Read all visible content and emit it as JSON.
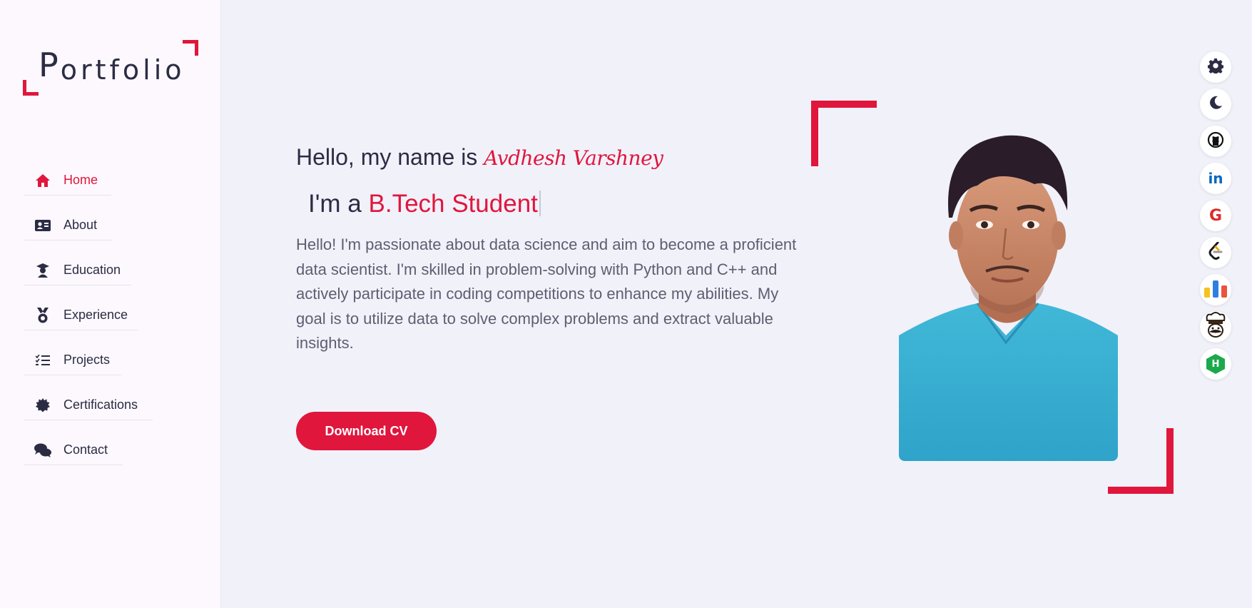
{
  "sidebar": {
    "logo": "Portfolio",
    "logo_first": "P",
    "logo_rest": "ortfolio",
    "items": [
      {
        "label": "Home",
        "icon": "home-icon",
        "active": true
      },
      {
        "label": "About",
        "icon": "id-card-icon"
      },
      {
        "label": "Education",
        "icon": "graduate-icon"
      },
      {
        "label": "Experience",
        "icon": "medal-icon"
      },
      {
        "label": "Projects",
        "icon": "tasks-icon"
      },
      {
        "label": "Certifications",
        "icon": "certificate-icon"
      },
      {
        "label": "Contact",
        "icon": "chat-icon"
      }
    ]
  },
  "hero": {
    "greeting": "Hello, my name is",
    "name": "Avdhesh Varshney",
    "role_prefix": "I'm a",
    "role": "B.Tech Student",
    "bio": "Hello! I'm passionate about data science and aim to become a proficient data scientist. I'm skilled in problem-solving with Python and C++ and actively participate in coding competitions to enhance my abilities. My goal is to utilize data to solve complex problems and extract valuable insights.",
    "cv_button": "Download CV"
  },
  "social": [
    {
      "name": "settings",
      "icon": "gear-icon"
    },
    {
      "name": "dark-mode",
      "icon": "moon-icon"
    },
    {
      "name": "github",
      "icon": "github-icon"
    },
    {
      "name": "linkedin",
      "icon": "linkedin-icon",
      "text": "in"
    },
    {
      "name": "google",
      "icon": "google-icon",
      "text": "G"
    },
    {
      "name": "leetcode",
      "icon": "leetcode-icon"
    },
    {
      "name": "stats",
      "icon": "bar-chart-icon"
    },
    {
      "name": "codechef",
      "icon": "chef-icon"
    },
    {
      "name": "hackerrank",
      "icon": "hackerrank-icon",
      "text": "H"
    }
  ],
  "colors": {
    "accent": "#e0163c",
    "text": "#2b2c44",
    "background": "#f1f1fa",
    "sidebar": "#fcf8fd"
  }
}
